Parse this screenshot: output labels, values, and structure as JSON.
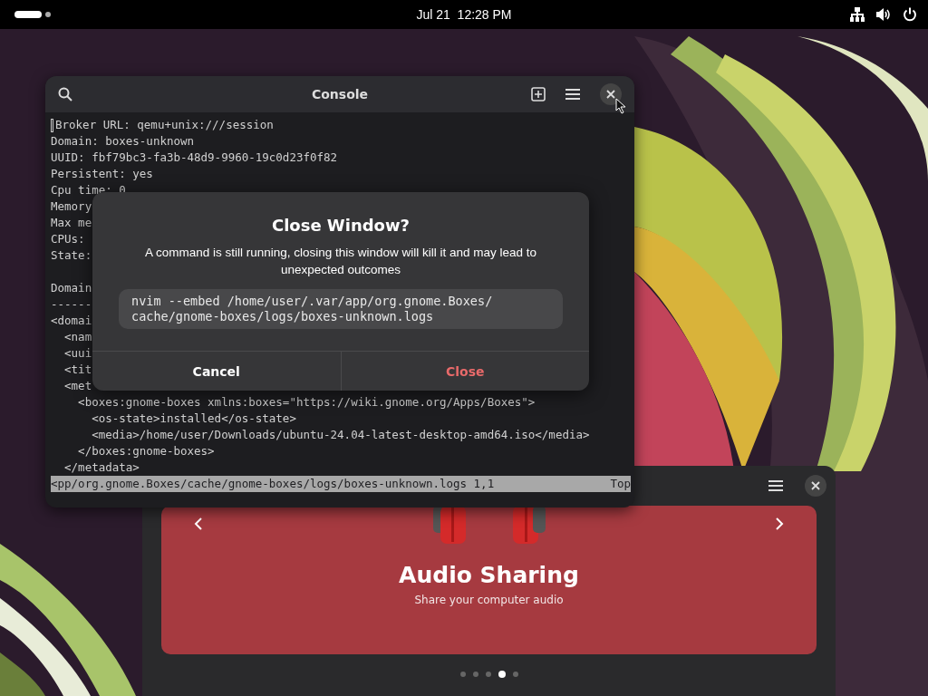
{
  "top_bar": {
    "clock": "Jul 21  12:28 PM"
  },
  "console": {
    "title": "Console",
    "blocks": [
      {
        "lines": [
          "Broker URL: qemu+unix:///session",
          "Domain: boxes-unknown",
          "UUID: fbf79bc3-fa3b-48d9-9960-19c0d23f0f82",
          "Persistent: yes",
          "Cpu time: 0",
          "Memory",
          "Max me",
          "CPUs:",
          "State:"
        ]
      },
      {
        "lines": [
          "Domain",
          "------",
          "<domai",
          "  <nam",
          "  <uui",
          "  <tit",
          "  <met",
          "    <boxes:gnome-boxes xmlns:boxes=\"https://wiki.gnome.org/Apps/Boxes\">",
          "      <os-state>installed</os-state>",
          "      <media>/home/user/Downloads/ubuntu-24.04-latest-desktop-amd64.iso</media>",
          "    </boxes:gnome-boxes>",
          "  </metadata>"
        ]
      }
    ],
    "status_line": {
      "path": "<pp/org.gnome.Boxes/cache/gnome-boxes/logs/boxes-unknown.logs 1,1",
      "position": "Top"
    }
  },
  "dialog": {
    "title": "Close Window?",
    "message": "A command is still running, closing this window will kill it and may lead to unexpected outcomes",
    "command": "nvim --embed /home/user/.var/app/org.gnome.Boxes/cache/gnome-boxes/logs/boxes-unknown.logs",
    "buttons": [
      {
        "label": "Cancel",
        "kind": "default"
      },
      {
        "label": "Close",
        "kind": "destructive"
      }
    ]
  },
  "welcome": {
    "title": "Audio Sharing",
    "subtitle": "Share your computer audio",
    "pages": [
      {
        "selected": false
      },
      {
        "selected": false
      },
      {
        "selected": false
      },
      {
        "selected": true
      },
      {
        "selected": false
      }
    ]
  }
}
